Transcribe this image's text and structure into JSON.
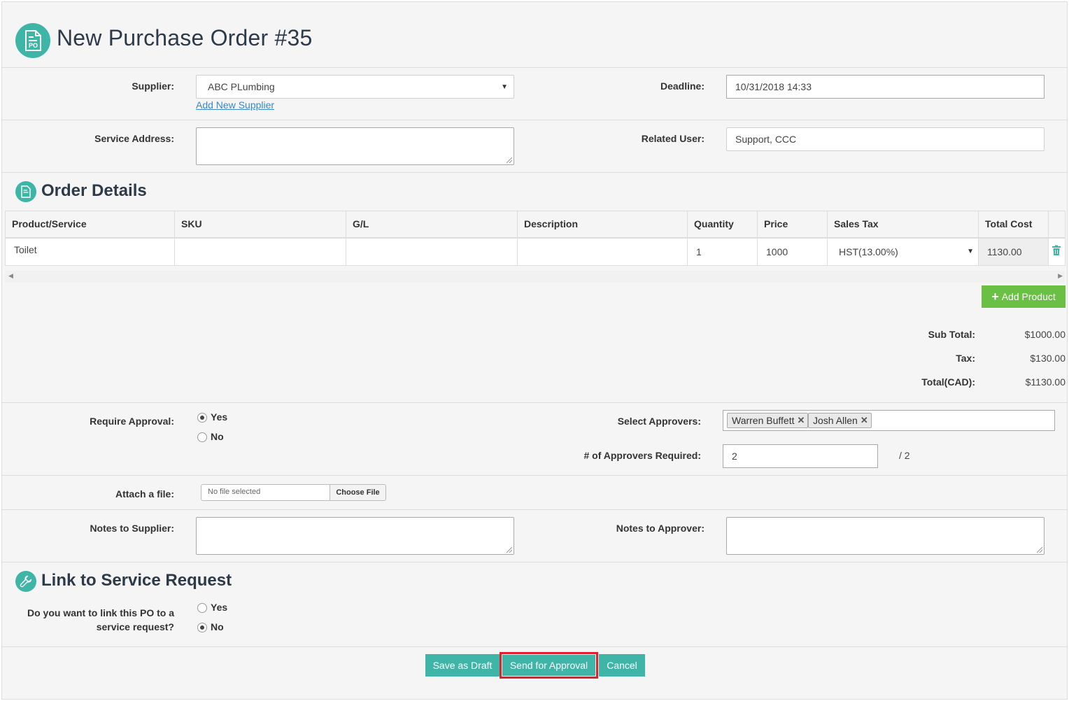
{
  "header": {
    "title": "New Purchase Order #35",
    "icon": "po-document-icon",
    "icon_text": "PO"
  },
  "form": {
    "supplier_label": "Supplier:",
    "supplier_value": "ABC PLumbing",
    "add_supplier_link": "Add New Supplier",
    "deadline_label": "Deadline:",
    "deadline_value": "10/31/2018 14:33",
    "service_address_label": "Service Address:",
    "related_user_label": "Related User:",
    "related_user_value": "Support, CCC"
  },
  "order_details": {
    "title": "Order Details",
    "columns": [
      "Product/Service",
      "SKU",
      "G/L",
      "Description",
      "Quantity",
      "Price",
      "Sales Tax",
      "Total Cost"
    ],
    "rows": [
      {
        "product": "Toilet",
        "sku": "",
        "gl": "",
        "description": "",
        "quantity": "1",
        "price": "1000",
        "sales_tax": "HST(13.00%)",
        "total_cost": "1130.00"
      }
    ],
    "add_product_label": "Add Product"
  },
  "totals": {
    "subtotal_label": "Sub Total:",
    "subtotal_value": "$1000.00",
    "tax_label": "Tax:",
    "tax_value": "$130.00",
    "total_label": "Total(CAD):",
    "total_value": "$1130.00"
  },
  "approval": {
    "require_label": "Require Approval:",
    "yes_label": "Yes",
    "no_label": "No",
    "selected": "Yes",
    "select_approvers_label": "Select Approvers:",
    "approvers": [
      "Warren Buffett",
      "Josh Allen"
    ],
    "required_count_label": "# of Approvers Required:",
    "required_count_value": "2",
    "required_count_total": "/ 2"
  },
  "attachment": {
    "label": "Attach a file:",
    "status": "No file selected",
    "button": "Choose File"
  },
  "notes": {
    "supplier_label": "Notes to Supplier:",
    "approver_label": "Notes to Approver:"
  },
  "service_request": {
    "title": "Link to Service Request",
    "question_line1": "Do you want to link this PO to a",
    "question_line2": "service request?",
    "yes_label": "Yes",
    "no_label": "No",
    "selected": "No"
  },
  "actions": {
    "save_draft": "Save as Draft",
    "send_approval": "Send for Approval",
    "cancel": "Cancel"
  },
  "colors": {
    "accent": "#3fb5a8",
    "add_button": "#6abf45",
    "highlight": "#e0202b"
  }
}
